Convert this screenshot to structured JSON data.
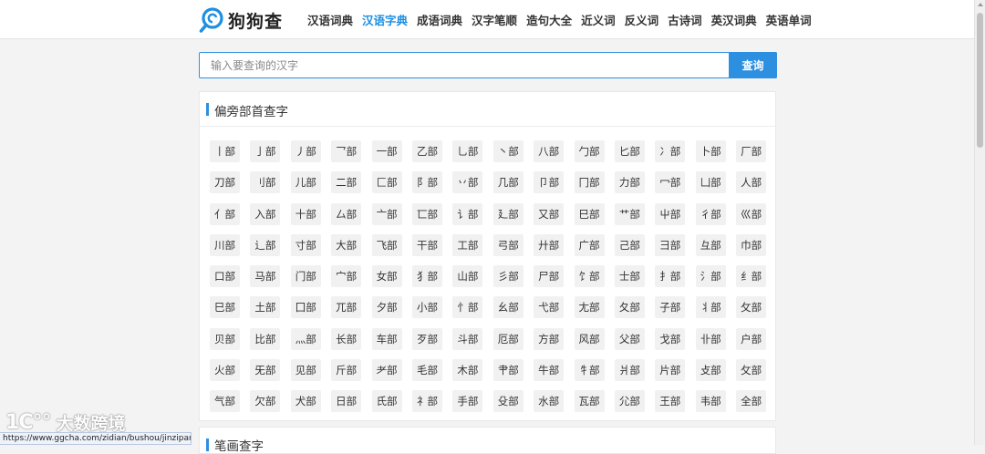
{
  "logo": {
    "text": "狗狗查",
    "icon": "magnifier-logo-icon",
    "brand_color": "#1e8fe1"
  },
  "nav": {
    "items": [
      "汉语词典",
      "汉语字典",
      "成语词典",
      "汉字笔顺",
      "造句大全",
      "近义词",
      "反义词",
      "古诗词",
      "英汉词典",
      "英语单词"
    ],
    "active_index": 1
  },
  "search": {
    "placeholder": "输入要查询的汉字",
    "value": "",
    "button_label": "查询"
  },
  "radical_panel": {
    "title": "偏旁部首查字",
    "items": [
      "丨部",
      "亅部",
      "丿部",
      "乛部",
      "一部",
      "乙部",
      "乚部",
      "丶部",
      "八部",
      "勹部",
      "匕部",
      "冫部",
      "卜部",
      "厂部",
      "刀部",
      "刂部",
      "儿部",
      "二部",
      "匚部",
      "阝部",
      "丷部",
      "几部",
      "卩部",
      "冂部",
      "力部",
      "冖部",
      "凵部",
      "人部",
      "亻部",
      "入部",
      "十部",
      "厶部",
      "亠部",
      "匸部",
      "讠部",
      "廴部",
      "又部",
      "巳部",
      "艹部",
      "屮部",
      "彳部",
      "巛部",
      "川部",
      "辶部",
      "寸部",
      "大部",
      "飞部",
      "干部",
      "工部",
      "弓部",
      "廾部",
      "广部",
      "己部",
      "彐部",
      "彑部",
      "巾部",
      "口部",
      "马部",
      "门部",
      "宀部",
      "女部",
      "犭部",
      "山部",
      "彡部",
      "尸部",
      "饣部",
      "士部",
      "扌部",
      "氵部",
      "纟部",
      "巳部",
      "土部",
      "囗部",
      "兀部",
      "夕部",
      "小部",
      "忄部",
      "幺部",
      "弋部",
      "尢部",
      "夂部",
      "子部",
      "丬部",
      "攵部",
      "贝部",
      "比部",
      "灬部",
      "长部",
      "车部",
      "歹部",
      "斗部",
      "厄部",
      "方部",
      "风部",
      "父部",
      "戈部",
      "卝部",
      "户部",
      "火部",
      "旡部",
      "见部",
      "斤部",
      "耂部",
      "毛部",
      "木部",
      "肀部",
      "牛部",
      "牜部",
      "爿部",
      "片部",
      "攴部",
      "攵部",
      "气部",
      "欠部",
      "犬部",
      "日部",
      "氏部",
      "礻部",
      "手部",
      "殳部",
      "水部",
      "瓦部",
      "尣部",
      "王部",
      "韦部",
      "全部"
    ]
  },
  "stroke_panel": {
    "title": "笔画查字"
  },
  "watermark": {
    "logo": "1C°°",
    "text": "大数跨境"
  },
  "status_url": "https://www.ggcha.com/zidian/bushou/jinzipang/"
}
